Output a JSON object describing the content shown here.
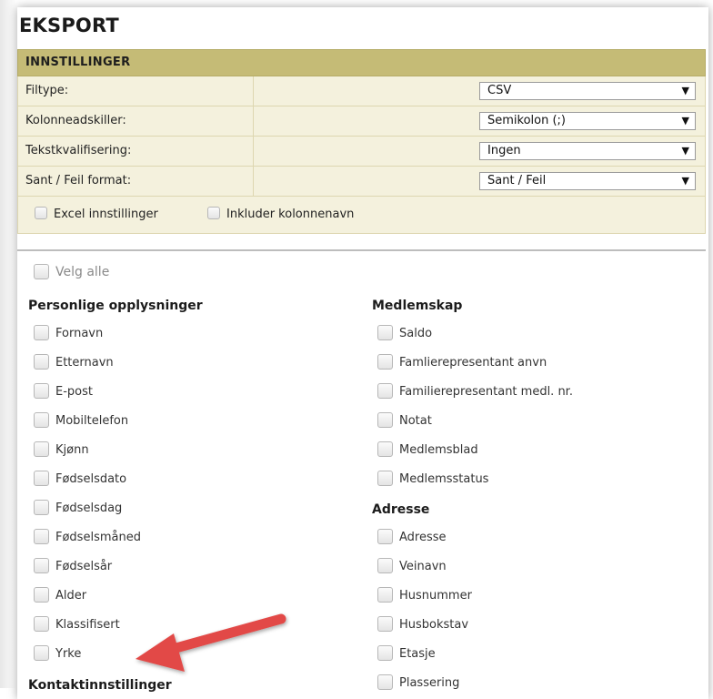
{
  "page": {
    "title": "EKSPORT"
  },
  "settings": {
    "header": "INNSTILLINGER",
    "rows": [
      {
        "label": "Filtype:",
        "value": "CSV"
      },
      {
        "label": "Kolonneadskiller:",
        "value": "Semikolon (;)"
      },
      {
        "label": "Tekstkvalifisering:",
        "value": "Ingen"
      },
      {
        "label": "Sant / Feil format:",
        "value": "Sant / Feil"
      }
    ],
    "options": [
      {
        "label": "Excel innstillinger",
        "checked": false
      },
      {
        "label": "Inkluder kolonnenavn",
        "checked": false
      }
    ]
  },
  "select_all": {
    "label": "Velg alle",
    "checked": false
  },
  "left_column": {
    "heading": "Personlige opplysninger",
    "items": [
      "Fornavn",
      "Etternavn",
      "E-post",
      "Mobiltelefon",
      "Kjønn",
      "Fødselsdato",
      "Fødselsdag",
      "Fødselsmåned",
      "Fødselsår",
      "Alder",
      "Klassifisert",
      "Yrke"
    ],
    "next_heading": "Kontaktinnstillinger"
  },
  "right_column": {
    "heading": "Medlemskap",
    "items": [
      "Saldo",
      "Famlierepresentant anvn",
      "Familierepresentant medl. nr.",
      "Notat",
      "Medlemsblad",
      "Medlemsstatus"
    ],
    "heading2": "Adresse",
    "items2": [
      "Adresse",
      "Veinavn",
      "Husnummer",
      "Husbokstav",
      "Etasje",
      "Plassering"
    ]
  },
  "annotation": {
    "arrow_color": "#e24a46"
  },
  "icons": {
    "dropdown": "triangle-down-icon",
    "checkbox": "checkbox-icon"
  }
}
